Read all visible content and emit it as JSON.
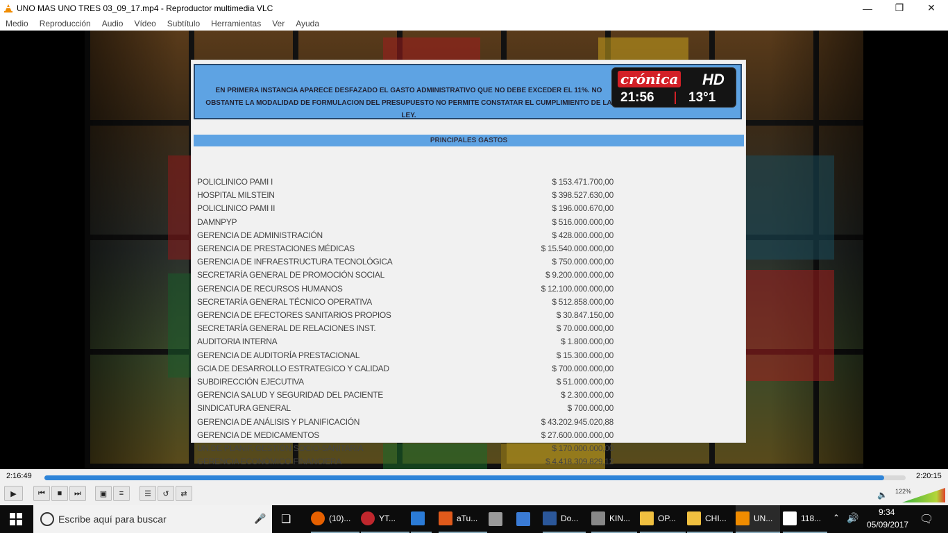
{
  "window": {
    "title": "UNO MAS UNO TRES 03_09_17.mp4 - Reproductor multimedia VLC"
  },
  "menu": [
    "Medio",
    "Reproducción",
    "Audio",
    "Vídeo",
    "Subtítulo",
    "Herramientas",
    "Ver",
    "Ayuda"
  ],
  "video": {
    "banner_text": "EN PRIMERA INSTANCIA APARECE DESFAZADO EL GASTO ADMINISTRATIVO QUE NO DEBE EXCEDER EL 11%. NO OBSTANTE LA MODALIDAD DE FORMULACION DEL PRESUPUESTO NO PERMITE CONSTATAR EL CUMPLIMIENTO DE LA LEY.",
    "logo": {
      "brand": "crónica",
      "hd": "HD",
      "clock": "21:56",
      "temp": "13°1"
    },
    "table_header": "PRINCIPALES GASTOS",
    "rows": [
      {
        "label": "POLICLINICO PAMI I",
        "amount": "$ 153.471.700,00"
      },
      {
        "label": "HOSPITAL MILSTEIN",
        "amount": "$ 398.527.630,00"
      },
      {
        "label": "POLICLINICO PAMI II",
        "amount": "$ 196.000.670,00"
      },
      {
        "label": "DAMNPYP",
        "amount": "$ 516.000.000,00"
      },
      {
        "label": "GERENCIA DE ADMINISTRACIÓN",
        "amount": "$ 428.000.000,00"
      },
      {
        "label": "GERENCIA DE PRESTACIONES MÉDICAS",
        "amount": "$ 15.540.000.000,00"
      },
      {
        "label": "GERENCIA DE INFRAESTRUCTURA TECNOLÓGICA",
        "amount": "$ 750.000.000,00"
      },
      {
        "label": "SECRETARÍA GENERAL DE PROMOCIÓN SOCIAL",
        "amount": "$ 9.200.000.000,00"
      },
      {
        "label": "GERENCIA DE RECURSOS HUMANOS",
        "amount": "$ 12.100.000.000,00"
      },
      {
        "label": "SECRETARÍA GENERAL TÉCNICO OPERATIVA",
        "amount": "$ 512.858.000,00"
      },
      {
        "label": "GERENCIA DE EFECTORES SANITARIOS PROPIOS",
        "amount": "$ 30.847.150,00"
      },
      {
        "label": "SECRETARÍA GENERAL DE RELACIONES INST.",
        "amount": "$ 70.000.000,00"
      },
      {
        "label": "AUDITORIA INTERNA",
        "amount": "$ 1.800.000,00"
      },
      {
        "label": "GERENCIA DE AUDITORÍA PRESTACIONAL",
        "amount": "$ 15.300.000,00"
      },
      {
        "label": "GCIA DE DESARROLLO ESTRATEGICO Y CALIDAD",
        "amount": "$ 700.000.000,00"
      },
      {
        "label": "SUBDIRECCIÓN EJECUTIVA",
        "amount": "$ 51.000.000,00"
      },
      {
        "label": "GERENCIA SALUD Y SEGURIDAD DEL PACIENTE",
        "amount": "$ 2.300.000,00"
      },
      {
        "label": "SINDICATURA GENERAL",
        "amount": "$ 700.000,00"
      },
      {
        "label": "GERENCIA DE ANÁLISIS Y PLANIFICACIÓN",
        "amount": "$ 43.202.945.020,88"
      },
      {
        "label": "GERENCIA DE MEDICAMENTOS",
        "amount": "$ 27.600.000.000,00"
      },
      {
        "label": "UN.DE PLANIF. GESTIÓN SOCIO-SANITARIA",
        "amount": "$ 170.000.000,00"
      },
      {
        "label": "GERENCIA ECONÓMICO FINANCIERA",
        "amount": "$ 4.418.309.829,12"
      }
    ]
  },
  "player": {
    "elapsed": "2:16:49",
    "total": "2:20:15",
    "progress": 0.975,
    "volume": "122%"
  },
  "taskbar": {
    "search_placeholder": "Escribe aquí para buscar",
    "apps": [
      {
        "label": "(10)...",
        "color": "#e66000"
      },
      {
        "label": "YT...",
        "color": "#c0272d"
      },
      {
        "label": "",
        "color": "#2b7bd6"
      },
      {
        "label": "aTu...",
        "color": "#e05a1b"
      },
      {
        "label": "",
        "color": "#9a9a9a"
      },
      {
        "label": "",
        "color": "#3a7bd5"
      },
      {
        "label": "Do...",
        "color": "#2b579a"
      },
      {
        "label": "KIN...",
        "color": "#888888"
      },
      {
        "label": "OP...",
        "color": "#f0c040"
      },
      {
        "label": "CHI...",
        "color": "#f0c040"
      },
      {
        "label": "UN...",
        "color": "#f08c00"
      },
      {
        "label": "118...",
        "color": "#ffffff"
      }
    ],
    "time": "9:34",
    "date": "05/09/2017"
  }
}
